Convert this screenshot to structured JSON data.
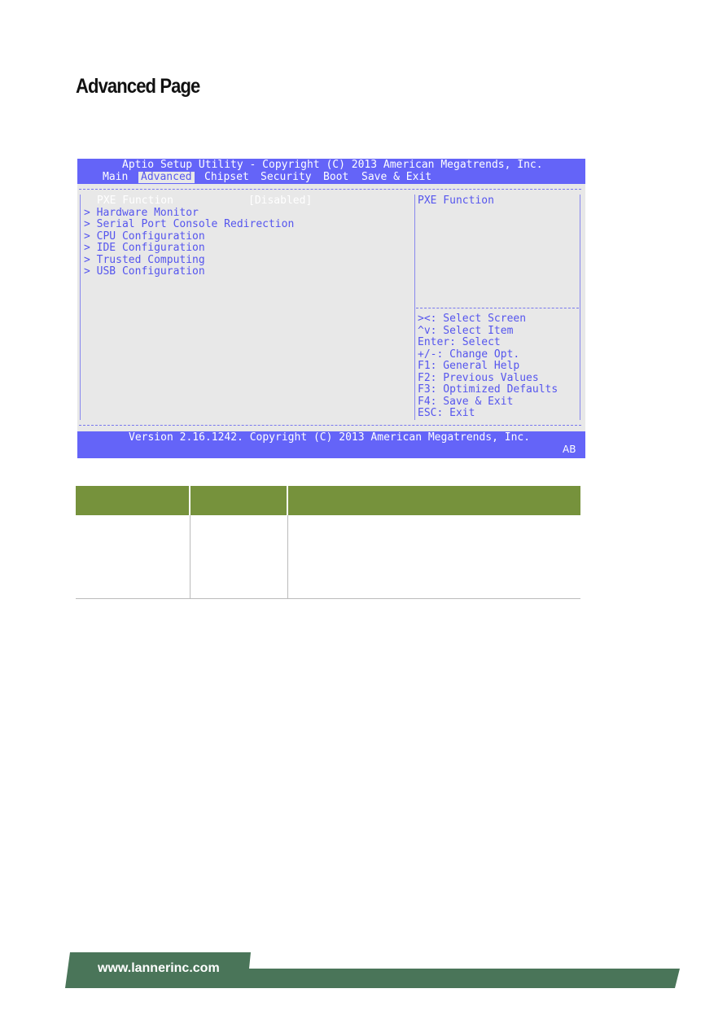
{
  "document": {
    "title": "Advanced Page",
    "footer_url": "www.lannerinc.com"
  },
  "bios": {
    "header": "Aptio Setup Utility - Copyright (C) 2013 American Megatrends, Inc.",
    "tabs": [
      "Main",
      "Advanced",
      "Chipset",
      "Security",
      "Boot",
      "Save & Exit"
    ],
    "selected_tab": "Advanced",
    "selected_item": {
      "label": "PXE Function",
      "value": "[Disabled]"
    },
    "items": [
      "> Hardware Monitor",
      "> Serial Port Console Redirection",
      "> CPU Configuration",
      "> IDE Configuration",
      "> Trusted Computing",
      "> USB Configuration"
    ],
    "help_title": "PXE Function",
    "keys": [
      "><: Select Screen",
      "^v: Select Item",
      "Enter: Select",
      "+/-: Change Opt.",
      "F1: General Help",
      "F2: Previous Values",
      "F3: Optimized Defaults",
      "F4: Save & Exit",
      "ESC: Exit"
    ],
    "footer": "Version 2.16.1242. Copyright (C) 2013 American Megatrends, Inc.",
    "footer_badge": "AB",
    "colors": {
      "bar": "#6464f8",
      "body": "#e8e8e8",
      "text": "#5555ee"
    }
  },
  "table": {
    "header_color": "#76923c",
    "footer_color": "#4a7559"
  }
}
